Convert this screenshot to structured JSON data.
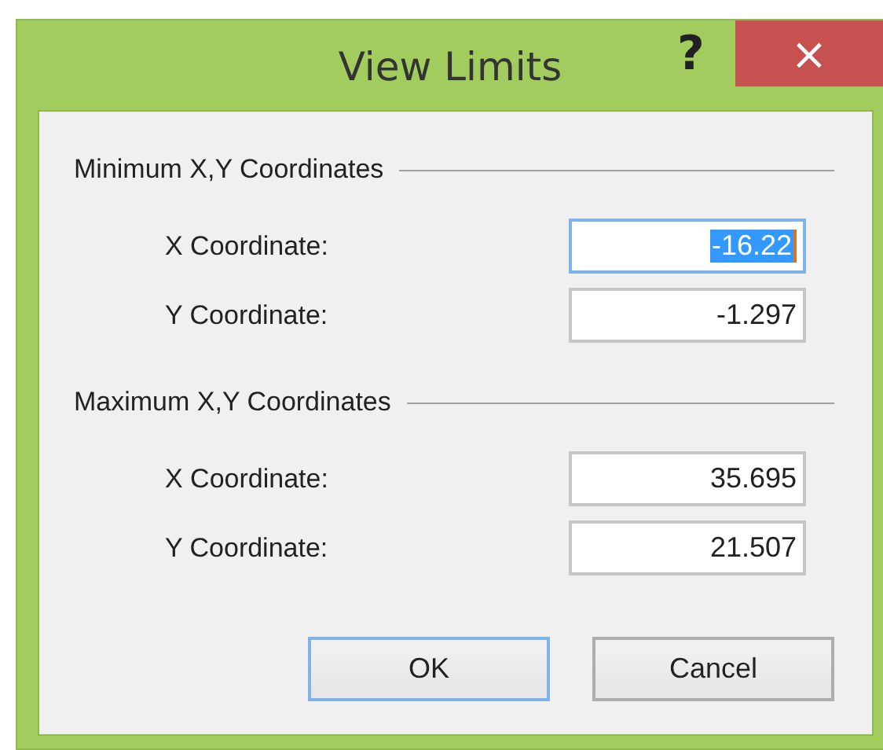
{
  "window": {
    "title": "View Limits",
    "help": "?",
    "close": "×"
  },
  "groups": [
    {
      "title": "Minimum X,Y Coordinates",
      "fields": [
        {
          "label": "X Coordinate:",
          "value": "-16.22",
          "focused": true
        },
        {
          "label": "Y Coordinate:",
          "value": "-1.297",
          "focused": false
        }
      ]
    },
    {
      "title": "Maximum X,Y Coordinates",
      "fields": [
        {
          "label": "X Coordinate:",
          "value": "35.695",
          "focused": false
        },
        {
          "label": "Y Coordinate:",
          "value": "21.507",
          "focused": false
        }
      ]
    }
  ],
  "buttons": [
    {
      "label": "OK",
      "default": true
    },
    {
      "label": "Cancel",
      "default": false
    }
  ]
}
